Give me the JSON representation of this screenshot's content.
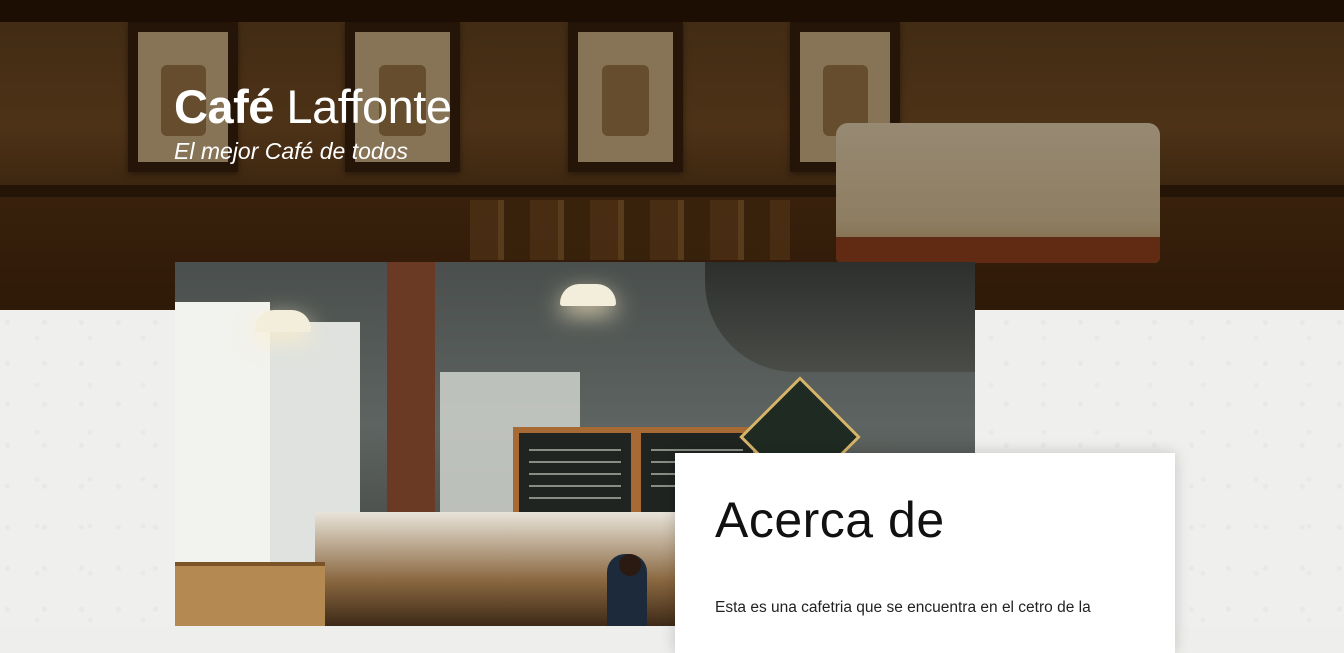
{
  "header": {
    "brand_bold": "Café",
    "brand_rest": " Laffonte",
    "tagline": "El mejor Café de todos"
  },
  "about": {
    "title": "Acerca de",
    "text": "Esta es una cafetria que se encuentra en el cetro de la"
  },
  "colors": {
    "hero_dark": "#3a2510",
    "page_bg": "#efefed",
    "card_bg": "#ffffff",
    "text_dark": "#111111"
  }
}
